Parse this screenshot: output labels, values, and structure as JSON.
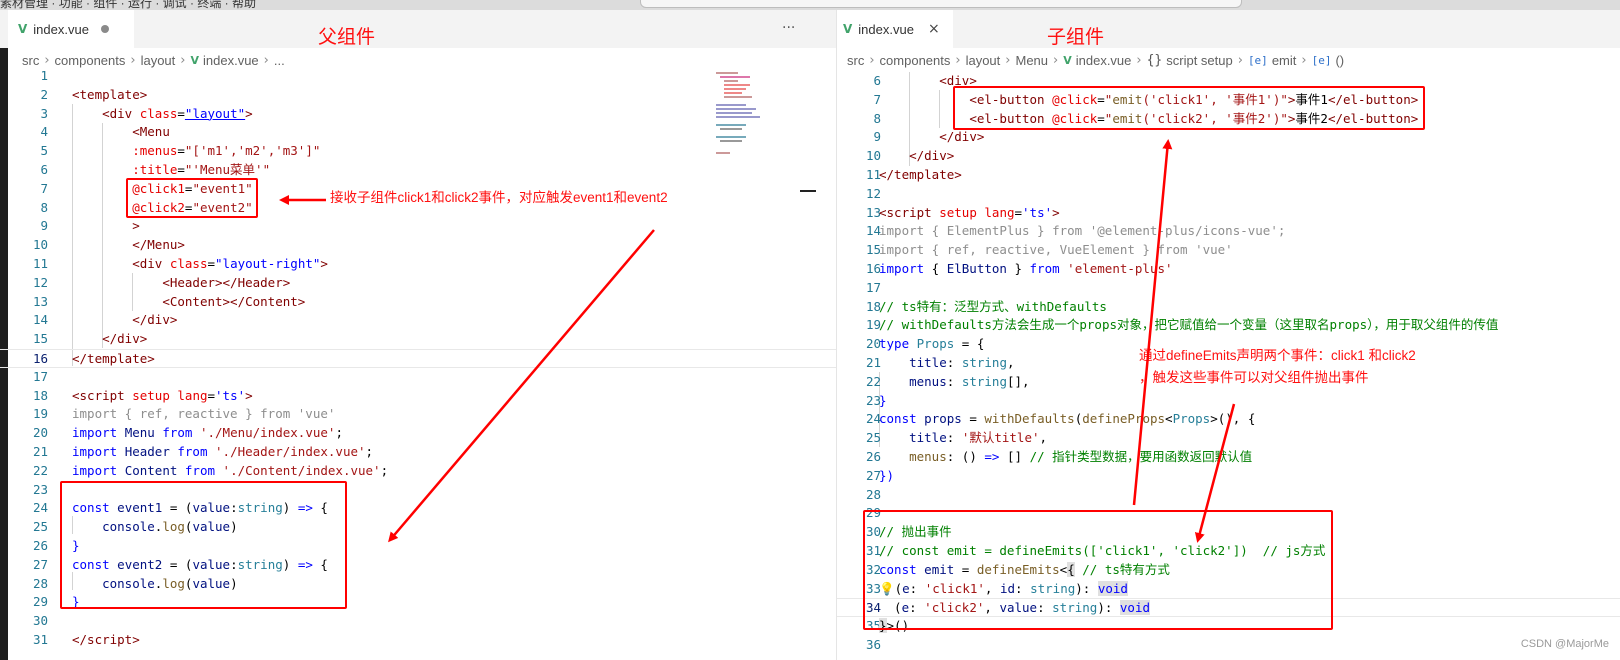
{
  "top_strip_text": "素材管理 · 功能 · 组件 · 运行 · 调试 · 终端 · 帮助",
  "left": {
    "tab_label": "index.vue",
    "more_label": "···",
    "breadcrumb": [
      "src",
      "components",
      "layout",
      "index.vue",
      "..."
    ],
    "heading": "父组件",
    "annotation": "接收子组件click1和click2事件，对应触发event1和event2",
    "line_numbers": [
      "1",
      "2",
      "3",
      "4",
      "5",
      "6",
      "7",
      "8",
      "9",
      "10",
      "11",
      "12",
      "13",
      "14",
      "15",
      "16",
      "17",
      "18",
      "19",
      "20",
      "21",
      "22",
      "23",
      "24",
      "25",
      "26",
      "27",
      "28",
      "29",
      "30",
      "31"
    ]
  },
  "right": {
    "tab_label": "index.vue",
    "close_label": "×",
    "breadcrumb": [
      "src",
      "components",
      "layout",
      "Menu",
      "index.vue",
      "script setup",
      "emit",
      "()"
    ],
    "heading": "子组件",
    "annotation_line1": "通过defineEmits声明两个事件：click1 和click2",
    "annotation_line2": "，触发这些事件可以对父组件抛出事件",
    "line_numbers": [
      "6",
      "7",
      "8",
      "9",
      "10",
      "11",
      "12",
      "13",
      "14",
      "15",
      "16",
      "17",
      "18",
      "19",
      "20",
      "21",
      "22",
      "23",
      "24",
      "25",
      "26",
      "27",
      "28",
      "29",
      "30",
      "31",
      "32",
      "33",
      "34",
      "35",
      "36"
    ]
  },
  "watermark": "CSDN @MajorMe",
  "colors": {
    "annotation_red": "#ff0000",
    "line_number": "#237893",
    "tag": "#800000",
    "attribute": "#e50000",
    "keyword": "#0000ff",
    "string": "#a31515",
    "comment": "#008000",
    "type": "#267f99",
    "vue_icon": "#41a36b"
  }
}
